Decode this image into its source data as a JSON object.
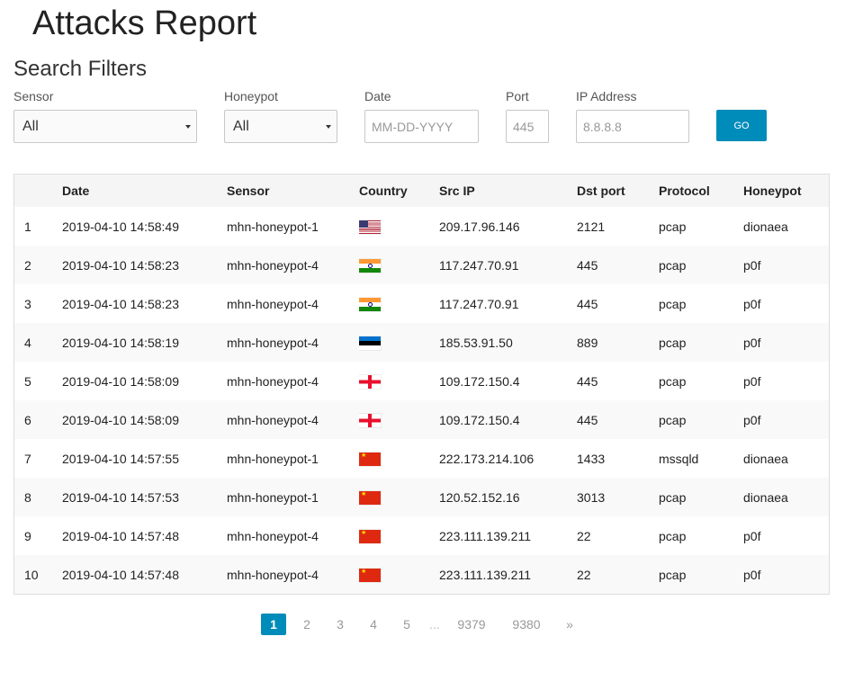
{
  "page": {
    "title": "Attacks Report"
  },
  "filters": {
    "title": "Search Filters",
    "sensor": {
      "label": "Sensor",
      "selected": "All"
    },
    "honeypot": {
      "label": "Honeypot",
      "selected": "All"
    },
    "date": {
      "label": "Date",
      "placeholder": "MM-DD-YYYY",
      "value": ""
    },
    "port": {
      "label": "Port",
      "placeholder": "445",
      "value": ""
    },
    "ip": {
      "label": "IP Address",
      "placeholder": "8.8.8.8",
      "value": ""
    },
    "go_label": "GO"
  },
  "table": {
    "headers": {
      "num": "",
      "date": "Date",
      "sensor": "Sensor",
      "country": "Country",
      "src_ip": "Src IP",
      "dst_port": "Dst port",
      "protocol": "Protocol",
      "honeypot": "Honeypot"
    },
    "rows": [
      {
        "num": "1",
        "date": "2019-04-10 14:58:49",
        "sensor": "mhn-honeypot-1",
        "country": "us",
        "src_ip": "209.17.96.146",
        "dst_port": "2121",
        "protocol": "pcap",
        "honeypot": "dionaea"
      },
      {
        "num": "2",
        "date": "2019-04-10 14:58:23",
        "sensor": "mhn-honeypot-4",
        "country": "in",
        "src_ip": "117.247.70.91",
        "dst_port": "445",
        "protocol": "pcap",
        "honeypot": "p0f"
      },
      {
        "num": "3",
        "date": "2019-04-10 14:58:23",
        "sensor": "mhn-honeypot-4",
        "country": "in",
        "src_ip": "117.247.70.91",
        "dst_port": "445",
        "protocol": "pcap",
        "honeypot": "p0f"
      },
      {
        "num": "4",
        "date": "2019-04-10 14:58:19",
        "sensor": "mhn-honeypot-4",
        "country": "ee",
        "src_ip": "185.53.91.50",
        "dst_port": "889",
        "protocol": "pcap",
        "honeypot": "p0f"
      },
      {
        "num": "5",
        "date": "2019-04-10 14:58:09",
        "sensor": "mhn-honeypot-4",
        "country": "ge",
        "src_ip": "109.172.150.4",
        "dst_port": "445",
        "protocol": "pcap",
        "honeypot": "p0f"
      },
      {
        "num": "6",
        "date": "2019-04-10 14:58:09",
        "sensor": "mhn-honeypot-4",
        "country": "ge",
        "src_ip": "109.172.150.4",
        "dst_port": "445",
        "protocol": "pcap",
        "honeypot": "p0f"
      },
      {
        "num": "7",
        "date": "2019-04-10 14:57:55",
        "sensor": "mhn-honeypot-1",
        "country": "cn",
        "src_ip": "222.173.214.106",
        "dst_port": "1433",
        "protocol": "mssqld",
        "honeypot": "dionaea"
      },
      {
        "num": "8",
        "date": "2019-04-10 14:57:53",
        "sensor": "mhn-honeypot-1",
        "country": "cn",
        "src_ip": "120.52.152.16",
        "dst_port": "3013",
        "protocol": "pcap",
        "honeypot": "dionaea"
      },
      {
        "num": "9",
        "date": "2019-04-10 14:57:48",
        "sensor": "mhn-honeypot-4",
        "country": "cn",
        "src_ip": "223.111.139.211",
        "dst_port": "22",
        "protocol": "pcap",
        "honeypot": "p0f"
      },
      {
        "num": "10",
        "date": "2019-04-10 14:57:48",
        "sensor": "mhn-honeypot-4",
        "country": "cn",
        "src_ip": "223.111.139.211",
        "dst_port": "22",
        "protocol": "pcap",
        "honeypot": "p0f"
      }
    ]
  },
  "pagination": {
    "current": "1",
    "pages": [
      "2",
      "3",
      "4",
      "5"
    ],
    "ellipsis": "...",
    "tail_pages": [
      "9379",
      "9380"
    ],
    "next": "»"
  },
  "colors": {
    "accent": "#008cba",
    "row_stripe": "#f9f9f9",
    "header_bg": "#f5f5f5"
  }
}
